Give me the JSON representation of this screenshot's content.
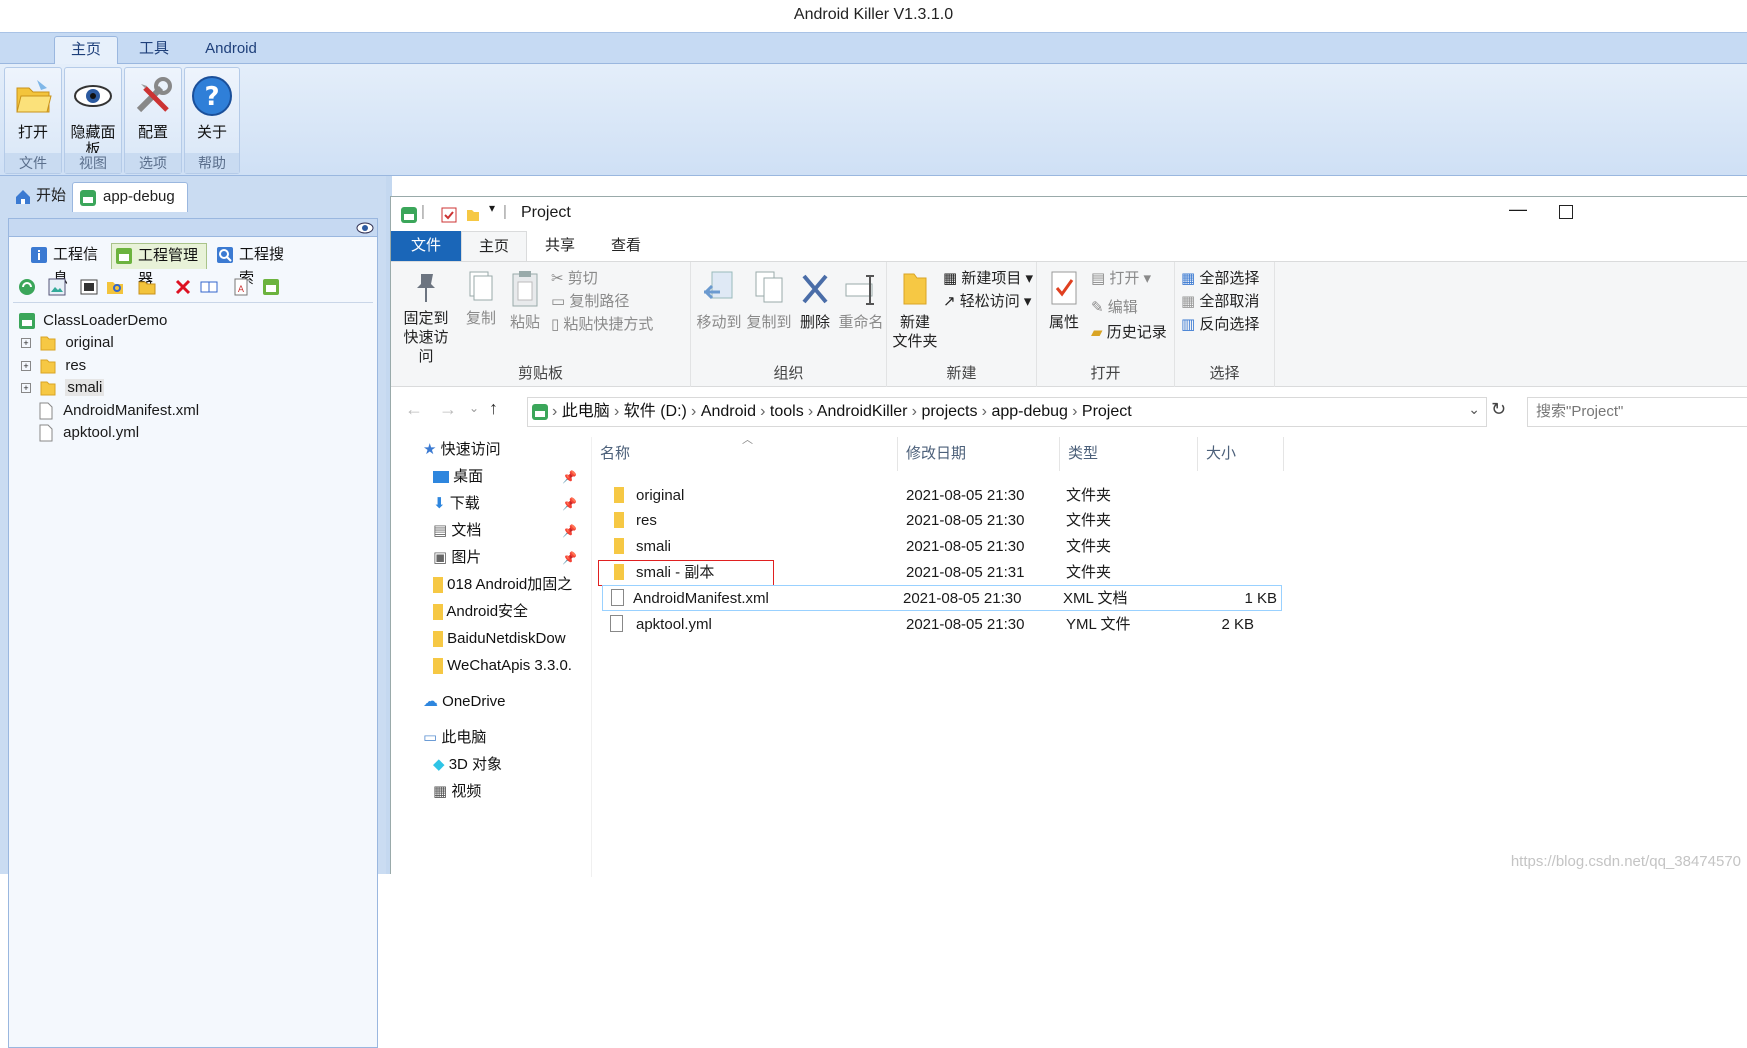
{
  "app": {
    "title": "Android Killer V1.3.1.0"
  },
  "menu_tabs": [
    "主页",
    "工具",
    "Android"
  ],
  "ribbon": {
    "groups": [
      {
        "button": "打开",
        "group": "文件"
      },
      {
        "button": "隐藏面\n板",
        "group": "视图"
      },
      {
        "button": "配置",
        "group": "选项"
      },
      {
        "button": "关于",
        "group": "帮助"
      }
    ]
  },
  "doc_tabs": [
    "开始",
    "app-debug"
  ],
  "panel_tabs": [
    "工程信息",
    "工程管理器",
    "工程搜索"
  ],
  "tree": {
    "root": "ClassLoaderDemo",
    "items": [
      "original",
      "res",
      "smali",
      "AndroidManifest.xml",
      "apktool.yml"
    ]
  },
  "explorer": {
    "title": "Project",
    "tabs": [
      "文件",
      "主页",
      "共享",
      "查看"
    ],
    "clipboard": {
      "pin": "固定到\n快速访问",
      "copy": "复制",
      "paste": "粘贴",
      "cut": "剪切",
      "copy_path": "复制路径",
      "paste_shortcut": "粘贴快捷方式",
      "group": "剪贴板"
    },
    "organize": {
      "move": "移动到",
      "copy_to": "复制到",
      "delete": "删除",
      "rename": "重命名",
      "group": "组织"
    },
    "new": {
      "folder": "新建\n文件夹",
      "new_item": "新建项目",
      "easy_access": "轻松访问",
      "group": "新建"
    },
    "open": {
      "properties": "属性",
      "open": "打开",
      "edit": "编辑",
      "history": "历史记录",
      "group": "打开"
    },
    "select": {
      "all": "全部选择",
      "none": "全部取消",
      "invert": "反向选择",
      "group": "选择"
    },
    "breadcrumb": [
      "此电脑",
      "软件 (D:)",
      "Android",
      "tools",
      "AndroidKiller",
      "projects",
      "app-debug",
      "Project"
    ],
    "search_placeholder": "搜索\"Project\"",
    "nav": {
      "quick_access": "快速访问",
      "items": [
        "桌面",
        "下载",
        "文档",
        "图片",
        "018 Android加固之",
        "Android安全",
        "BaiduNetdiskDow",
        "WeChatApis 3.3.0."
      ],
      "onedrive": "OneDrive",
      "this_pc": "此电脑",
      "pc_items": [
        "3D 对象",
        "视频"
      ]
    },
    "columns": [
      "名称",
      "修改日期",
      "类型",
      "大小"
    ],
    "files": [
      {
        "name": "original",
        "date": "2021-08-05 21:30",
        "type": "文件夹",
        "size": ""
      },
      {
        "name": "res",
        "date": "2021-08-05 21:30",
        "type": "文件夹",
        "size": ""
      },
      {
        "name": "smali",
        "date": "2021-08-05 21:30",
        "type": "文件夹",
        "size": ""
      },
      {
        "name": "smali - 副本",
        "date": "2021-08-05 21:31",
        "type": "文件夹",
        "size": ""
      },
      {
        "name": "AndroidManifest.xml",
        "date": "2021-08-05 21:30",
        "type": "XML 文档",
        "size": "1 KB"
      },
      {
        "name": "apktool.yml",
        "date": "2021-08-05 21:30",
        "type": "YML 文件",
        "size": "2 KB"
      }
    ]
  },
  "watermark": "https://blog.csdn.net/qq_38474570",
  "colors": {
    "ribbon_blue": "#c6daf3",
    "explorer_file_tab": "#1a66b8",
    "highlight_red": "#e02020",
    "folder_yellow": "#f6c844"
  }
}
